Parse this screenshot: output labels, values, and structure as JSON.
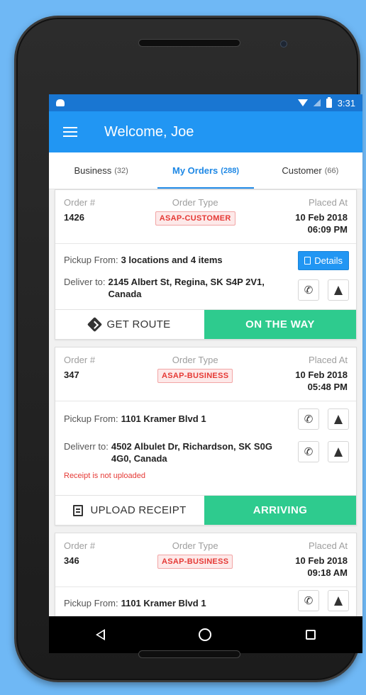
{
  "status_bar": {
    "time": "3:31"
  },
  "app_bar": {
    "title": "Welcome, Joe"
  },
  "tabs": [
    {
      "label": "Business",
      "count": "(32)"
    },
    {
      "label": "My Orders",
      "count": "(288)"
    },
    {
      "label": "Customer",
      "count": "(66)"
    }
  ],
  "labels": {
    "order_no": "Order #",
    "order_type": "Order Type",
    "placed_at": "Placed At",
    "pickup_from": "Pickup From:",
    "deliver_to": "Deliver to:",
    "deliverr_to": "Deliverr to:",
    "details": "Details",
    "get_route": "GET ROUTE",
    "upload_receipt": "UPLOAD RECEIPT"
  },
  "orders": [
    {
      "number": "1426",
      "type": "ASAP-CUSTOMER",
      "date": "10 Feb 2018",
      "time": "06:09 PM",
      "pickup": "3 locations and 4 items",
      "deliver": "2145 Albert St, Regina, SK S4P 2V1, Canada",
      "action": "ON THE WAY"
    },
    {
      "number": "347",
      "type": "ASAP-BUSINESS",
      "date": "10 Feb 2018",
      "time": "05:48 PM",
      "pickup": "1101 Kramer Blvd 1",
      "deliver": "4502 Albulet Dr, Richardson, SK S0G 4G0, Canada",
      "warning": "Receipt is not uploaded",
      "action": "ARRIVING"
    },
    {
      "number": "346",
      "type": "ASAP-BUSINESS",
      "date": "10 Feb 2018",
      "time": "09:18 AM",
      "pickup": "1101 Kramer Blvd 1"
    }
  ],
  "colors": {
    "background": "#6fb8f5",
    "status_bar": "#1976d2",
    "app_bar": "#2196f3",
    "tab_active": "#1e88e5",
    "badge_red": "#e53935",
    "action_green": "#2ecb8e"
  },
  "icons": [
    "android-icon",
    "wifi-icon",
    "signal-icon",
    "battery-icon",
    "menu-icon",
    "document-icon",
    "phone-icon",
    "navigate-icon",
    "route-icon",
    "receipt-icon",
    "back-icon",
    "home-icon",
    "recent-apps-icon"
  ]
}
